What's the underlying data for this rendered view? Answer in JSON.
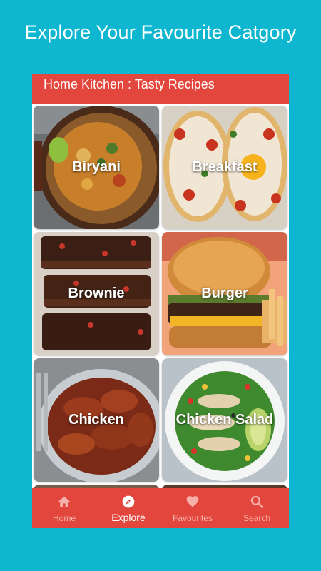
{
  "headline": "Explore Your Favourite Catgory",
  "appbar": {
    "title": "Home Kitchen : Tasty Recipes"
  },
  "categories": [
    {
      "label": "Biryani",
      "icon": "biryani-photo"
    },
    {
      "label": "Breakfast",
      "icon": "breakfast-photo"
    },
    {
      "label": "Brownie",
      "icon": "brownie-photo"
    },
    {
      "label": "Burger",
      "icon": "burger-photo"
    },
    {
      "label": "Chicken",
      "icon": "chicken-photo"
    },
    {
      "label": "Chicken Salad",
      "icon": "chicken-salad-photo"
    }
  ],
  "bottom_nav": {
    "items": [
      {
        "label": "Home",
        "icon": "home-icon"
      },
      {
        "label": "Explore",
        "icon": "compass-icon",
        "active": true
      },
      {
        "label": "Favourites",
        "icon": "heart-icon"
      },
      {
        "label": "Search",
        "icon": "search-icon"
      }
    ]
  },
  "colors": {
    "background": "#0fb6cf",
    "accent": "#e2463c",
    "nav_inactive": "#f6b1aa",
    "nav_active": "#ffffff"
  }
}
